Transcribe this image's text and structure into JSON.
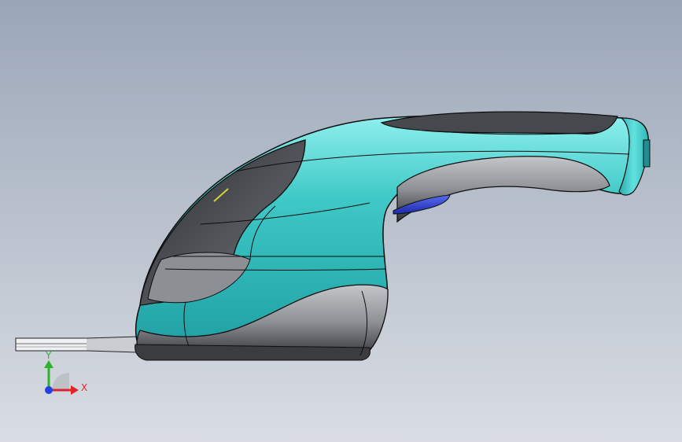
{
  "viewport": {
    "background_top": "#9aa6b8",
    "background_bottom": "#d9dde3"
  },
  "model": {
    "body_color": "#3ec8c6",
    "body_dark": "#1f8f93",
    "grip_color": "#4a4d52",
    "grip_highlight": "#8a8d92",
    "trigger_color": "#2b3fd6",
    "edge_color": "#101010",
    "blade_color": "#e9ecef"
  },
  "triad": {
    "x_label": "X",
    "y_label": "Y",
    "x_color": "#e0242a",
    "y_color": "#2ab52a",
    "z_color": "#2340e0"
  }
}
